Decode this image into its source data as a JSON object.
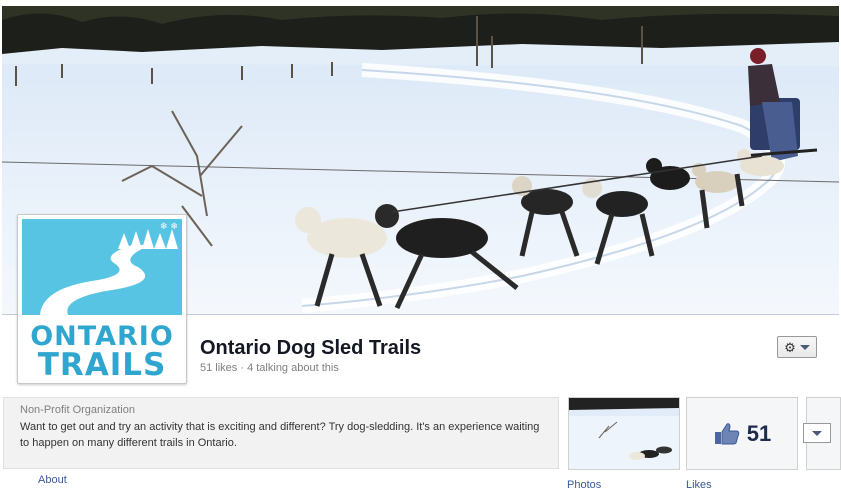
{
  "page": {
    "name": "Ontario Dog Sled Trails",
    "likes_text": "51 likes",
    "separator": " · ",
    "talking_text": "4 talking about this"
  },
  "logo": {
    "line1": "ONTARIO",
    "line2": "TRAILS"
  },
  "about": {
    "category": "Non-Profit Organization",
    "description": "Want to get out and try an activity that is exciting and different? Try dog-sledding. It's an experience waiting to happen on many different trails in Ontario.",
    "link_label": "About"
  },
  "tiles": {
    "photos_label": "Photos",
    "likes_count": "51",
    "likes_label": "Likes"
  },
  "icons": {
    "gear": "gear-icon",
    "chevron": "chevron-down-icon",
    "thumbs_up": "thumbs-up-icon"
  },
  "colors": {
    "link": "#3b5998",
    "logo_blue": "#2fa6cf",
    "title": "#141823"
  }
}
